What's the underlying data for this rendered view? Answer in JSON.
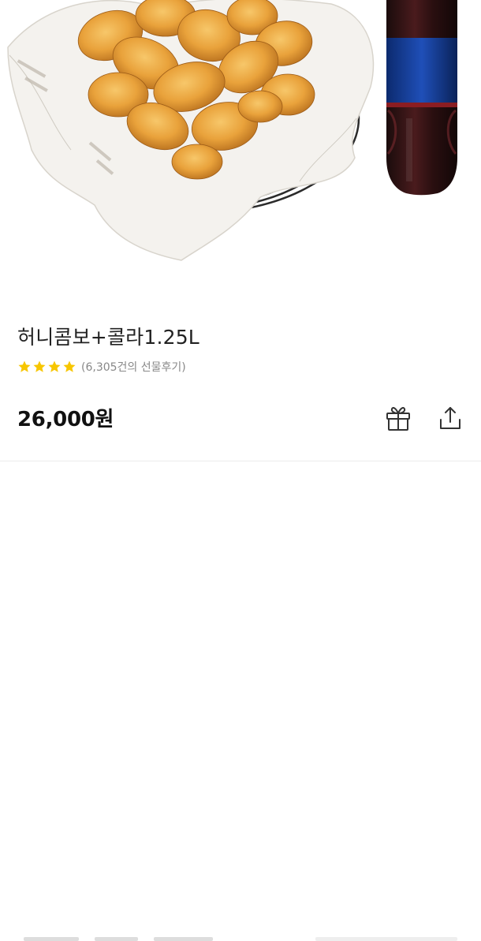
{
  "product": {
    "name": "허니콤보+콜라1.25L",
    "rating": 4,
    "rating_max": 4,
    "review_text": "(6,305건의 선물후기)",
    "price": "26,000원"
  },
  "actions": {
    "gift_icon": "gift-icon",
    "share_icon": "share-icon"
  },
  "colors": {
    "star": "#f7c600",
    "text": "#222222",
    "review": "#888888",
    "icon": "#333333"
  }
}
